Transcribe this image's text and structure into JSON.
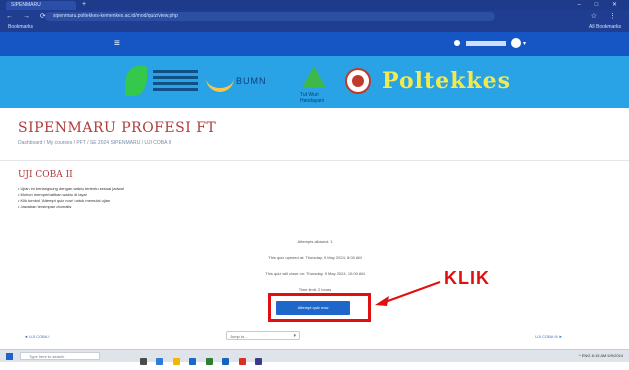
{
  "browser": {
    "tab_title": "SIPENMARU",
    "new_tab": "+",
    "window_controls": "– □ ✕",
    "nav_buttons": "← → ⟳ ⌂",
    "address": "sipenmaru.poltekkes-kemenkes.ac.id/mod/quiz/view.php",
    "toolbar_right": "☆ ⋮",
    "bookmark": "Bookmarks",
    "bookmark_right": "All Bookmarks"
  },
  "navbar": {
    "menu_icon": "≡",
    "user_caret": "▾"
  },
  "banner": {
    "bumn_text": "BUMN",
    "tut_text": "Tut Wuri Handayani",
    "poltekkes_text": "Poltekkes"
  },
  "page": {
    "title": "SIPENMARU PROFESI FT",
    "breadcrumb": "Dashboard / My courses / PFT / SE 2024 SIPENMARU / UJI COBA II"
  },
  "quiz": {
    "title": "UJI COBA II",
    "info": [
      "• Ujian ini berlangsung dengan waktu tertentu sesuai jadwal",
      "• Mohon memperhatikan waktu di layar",
      "• Klik tombol 'Attempt quiz now' untuk memulai ujian",
      "• Jawaban tersimpan otomatis"
    ],
    "summary": [
      "Attempts allowed: 1",
      "This quiz opened at: Thursday, 9 May 2024, 8:00 AM",
      "This quiz will close on: Thursday, 9 May 2024, 10:00 AM",
      "Time limit: 2 hours"
    ],
    "attempt_button": "Attempt quiz now",
    "callout": "KLIK"
  },
  "footer_nav": {
    "prev": "◄ UJI COBA I",
    "jump_placeholder": "Jump to...",
    "jump_caret": "▾",
    "next": "UJI COBA III ►"
  },
  "taskbar": {
    "search_placeholder": "Type here to search",
    "tray": "^ ENG 8:15 AM 5/9/2024"
  },
  "colors": {
    "navbar": "#1656c4",
    "banner": "#2aa3e6",
    "title_red": "#b03a3a",
    "button_blue": "#1e66c9",
    "callout_red": "#e01010"
  }
}
